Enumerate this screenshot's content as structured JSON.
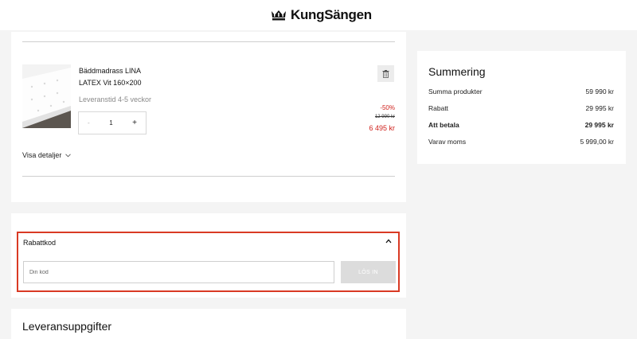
{
  "header": {
    "logo_text": "KungSängen",
    "logo_icon": "crown-icon"
  },
  "cart": {
    "product": {
      "name_line1": "Bäddmadrass LINA",
      "name_line2": "LATEX Vit 160×200",
      "delivery": "Leveranstid 4-5 veckor",
      "quantity": "1",
      "minus_label": "-",
      "plus_label": "+",
      "discount": "-50%",
      "old_price": "12 990 kr",
      "new_price": "6 495 kr"
    },
    "details_label": "Visa detaljer",
    "delete_icon": "trash-icon"
  },
  "summary": {
    "title": "Summering",
    "rows": [
      {
        "label": "Summa produkter",
        "value": "59 990 kr"
      },
      {
        "label": "Rabatt",
        "value": "29 995 kr"
      },
      {
        "label": "Att betala",
        "value": "29 995 kr"
      },
      {
        "label": "Varav moms",
        "value": "5 999,00 kr"
      }
    ]
  },
  "coupon": {
    "title": "Rabattkod",
    "placeholder": "Din kod",
    "button_label": "LÖS IN"
  },
  "delivery": {
    "title": "Leveransuppgifter"
  },
  "colors": {
    "accent_red": "#d0231e",
    "highlight_border": "#d93a24"
  }
}
